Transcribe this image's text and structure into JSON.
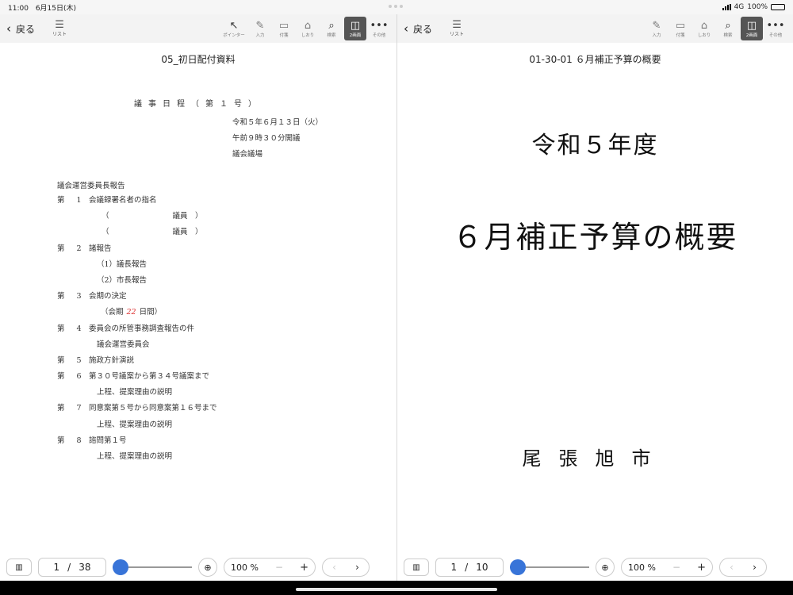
{
  "status": {
    "time": "11:00",
    "date": "6月15日(木)",
    "network": "4G",
    "battery": "100%"
  },
  "left_pane": {
    "toolbar": {
      "back": "戻る",
      "list": "リスト",
      "tools": [
        {
          "label": "ポインター",
          "icon": "↖"
        },
        {
          "label": "入力",
          "icon": "✎"
        },
        {
          "label": "付箋",
          "icon": "▭"
        },
        {
          "label": "しおり",
          "icon": "⌂"
        },
        {
          "label": "検索",
          "icon": "⌕"
        },
        {
          "label": "2画面",
          "icon": "◫"
        },
        {
          "label": "その他",
          "icon": "•••"
        }
      ]
    },
    "doc_title": "05_初日配付資料",
    "agenda_heading": "議事日程（第１号）",
    "meta": [
      "令和５年６月１３日（火）",
      "午前９時３０分開議",
      "議会議場"
    ],
    "report_head": "議会運営委員長報告",
    "items": {
      "i1": {
        "no": "第 1",
        "text": "会議録署名者の指名"
      },
      "p1": {
        "open": "（",
        "close": "議員　）"
      },
      "p2": {
        "open": "（",
        "close": "議員　）"
      },
      "i2": {
        "no": "第 2",
        "text": "諸報告"
      },
      "s2a": "（1）議長報告",
      "s2b": "（2）市長報告",
      "i3": {
        "no": "第 3",
        "text": "会期の決定"
      },
      "s3": {
        "prefix": "（会期",
        "handwritten": "22",
        "suffix": "日間）"
      },
      "i4": {
        "no": "第 4",
        "text": "委員会の所管事務調査報告の件"
      },
      "s4": "議会運営委員会",
      "i5": {
        "no": "第 5",
        "text": "施政方針演説"
      },
      "i6": {
        "no": "第 6",
        "text": "第３０号議案から第３４号議案まで"
      },
      "s6": "上程、提案理由の説明",
      "i7": {
        "no": "第 7",
        "text": "同意案第５号から同意案第１６号まで"
      },
      "s7": "上程、提案理由の説明",
      "i8": {
        "no": "第 8",
        "text": "諮問第１号"
      },
      "s8": "上程、提案理由の説明"
    },
    "bottom": {
      "page": "1",
      "sep": "/",
      "total": "38",
      "zoom": "100 %",
      "minus": "−",
      "plus": "+",
      "prev": "‹",
      "next": "›",
      "slider_fraction": 0.0
    }
  },
  "right_pane": {
    "toolbar": {
      "back": "戻る",
      "list": "リスト",
      "tools": [
        {
          "label": "入力",
          "icon": "✎"
        },
        {
          "label": "付箋",
          "icon": "▭"
        },
        {
          "label": "しおり",
          "icon": "⌂"
        },
        {
          "label": "検索",
          "icon": "⌕"
        },
        {
          "label": "2画面",
          "icon": "◫"
        },
        {
          "label": "その他",
          "icon": "•••"
        }
      ]
    },
    "doc_title": "01-30-01 ６月補正予算の概要",
    "cover_year": "令和５年度",
    "cover_title": "６月補正予算の概要",
    "cover_city": "尾張旭市",
    "bottom": {
      "page": "1",
      "sep": "/",
      "total": "10",
      "zoom": "100 %",
      "minus": "−",
      "plus": "+",
      "prev": "‹",
      "next": "›",
      "slider_fraction": 0.0
    }
  },
  "colors": {
    "accent": "#3874d8",
    "active_tool": "#555555",
    "handwriting": "#dd3333"
  }
}
